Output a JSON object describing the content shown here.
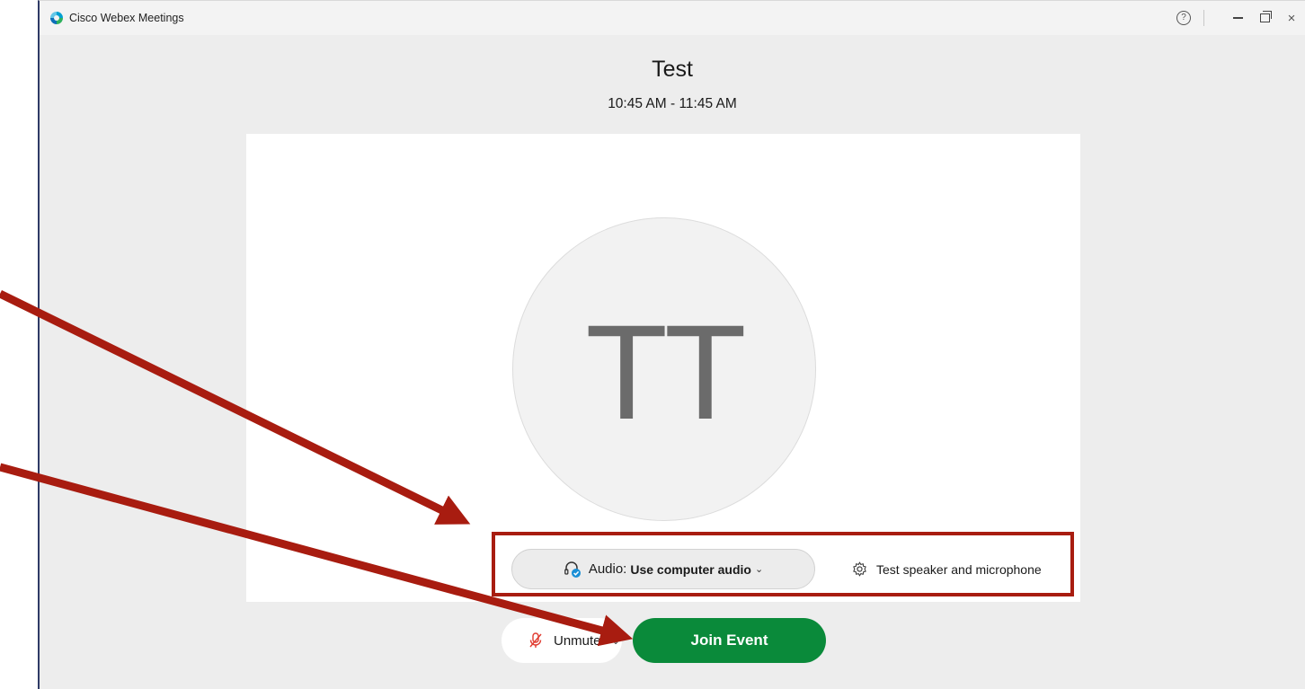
{
  "window": {
    "title": "Cisco Webex Meetings",
    "help_symbol": "?",
    "close_symbol": "×"
  },
  "meeting": {
    "title": "Test",
    "time": "10:45 AM - 11:45 AM"
  },
  "avatar": {
    "initials": "TT"
  },
  "audio": {
    "label_prefix": "Audio:",
    "value": "Use computer audio",
    "chevron": "⌄"
  },
  "test_speaker": {
    "label": "Test speaker and microphone"
  },
  "unmute": {
    "label": "Unmute",
    "chevron": "⌄"
  },
  "join": {
    "label": "Join Event"
  },
  "colors": {
    "join_green": "#0a8a3a",
    "annotation_red": "#a81c10",
    "mic_muted_red": "#e03a2f",
    "audio_badge_blue": "#1a8fd6"
  },
  "icons": {
    "app_logo": "webex-logo-icon",
    "help": "help-icon",
    "minimize": "minimize-icon",
    "restore": "restore-icon",
    "close": "close-icon",
    "headset": "headset-icon",
    "gear": "gear-icon",
    "mic_muted": "mic-muted-icon"
  }
}
